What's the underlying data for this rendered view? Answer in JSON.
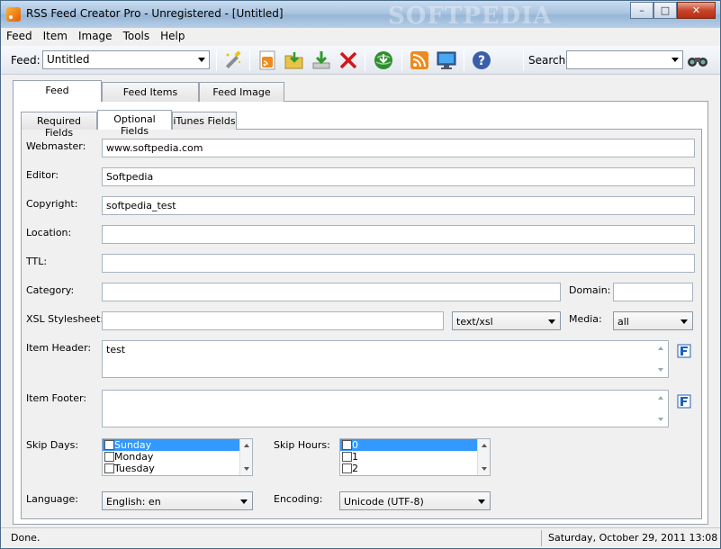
{
  "window": {
    "title": "RSS Feed Creator Pro - Unregistered - [Untitled]",
    "watermark": "SOFTPEDIA"
  },
  "title_buttons": {
    "minimize": "–",
    "maximize": "□",
    "close": "✕"
  },
  "menu": [
    "Feed",
    "Item",
    "Image",
    "Tools",
    "Help"
  ],
  "toolbar": {
    "feed_label": "Feed:",
    "feed_value": "Untitled",
    "search_label": "Search:",
    "search_value": "",
    "icons": [
      "wizard-icon",
      "rss-file-icon",
      "open-folder-icon",
      "download-icon",
      "delete-icon",
      "globe-icon",
      "rss-feed-icon",
      "monitor-icon",
      "help-icon",
      "binoculars-icon"
    ]
  },
  "outer_tabs": [
    "Feed",
    "Feed Items",
    "Feed Image"
  ],
  "inner_tabs": [
    "Required Fields",
    "Optional Fields",
    "iTunes Fields"
  ],
  "form": {
    "webmaster": {
      "label": "Webmaster:",
      "value": "www.softpedia.com"
    },
    "editor": {
      "label": "Editor:",
      "value": "Softpedia"
    },
    "copyright": {
      "label": "Copyright:",
      "value": "softpedia_test"
    },
    "location": {
      "label": "Location:",
      "value": ""
    },
    "ttl": {
      "label": "TTL:",
      "value": ""
    },
    "category": {
      "label": "Category:",
      "value": ""
    },
    "domain": {
      "label": "Domain:",
      "value": ""
    },
    "xsl": {
      "label": "XSL Stylesheet:",
      "value": "",
      "type_value": "text/xsl"
    },
    "media": {
      "label": "Media:",
      "value": "all"
    },
    "item_header": {
      "label": "Item Header:",
      "value": "test"
    },
    "item_footer": {
      "label": "Item Footer:",
      "value": ""
    },
    "skip_days": {
      "label": "Skip Days:",
      "options": [
        "Sunday",
        "Monday",
        "Tuesday"
      ],
      "selected": "Sunday"
    },
    "skip_hours": {
      "label": "Skip Hours:",
      "options": [
        "0",
        "1",
        "2"
      ],
      "selected": "0"
    },
    "language": {
      "label": "Language:",
      "value": "English: en"
    },
    "encoding": {
      "label": "Encoding:",
      "value": "Unicode (UTF-8)"
    }
  },
  "status": {
    "left": "Done.",
    "right": "Saturday, October 29, 2011 13:08"
  },
  "colors": {
    "selection": "#3399ff",
    "titlebar": "#a9c4e0"
  }
}
